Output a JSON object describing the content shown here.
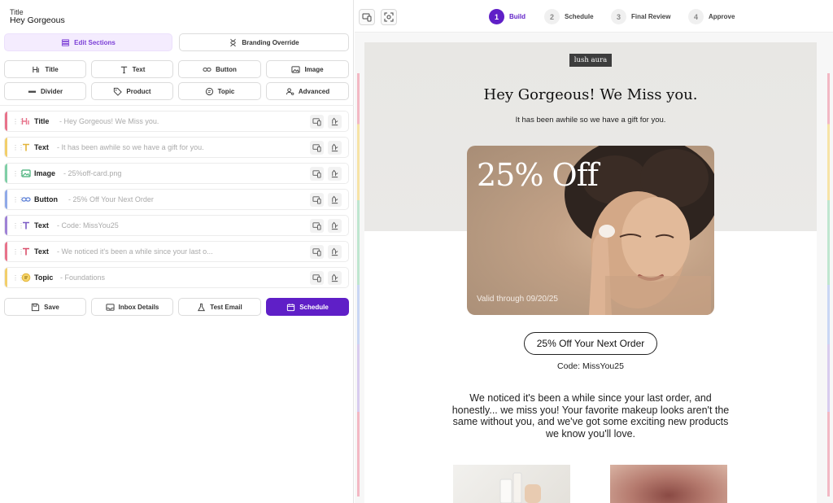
{
  "header": {
    "title_label": "Title",
    "title_value": "Hey Gorgeous"
  },
  "tabs": {
    "edit_sections": "Edit Sections",
    "branding_override": "Branding Override"
  },
  "add_blocks": [
    "Title",
    "Text",
    "Button",
    "Image",
    "Divider",
    "Product",
    "Topic",
    "Advanced"
  ],
  "sections": [
    {
      "kind": "Title",
      "summary": "- Hey Gorgeous! We Miss you.",
      "color": "#e8728a",
      "icon": "title-icon"
    },
    {
      "kind": "Text",
      "summary": "- It has been awhile so we have a gift for you.",
      "color": "#f2cf6b",
      "icon": "text-icon"
    },
    {
      "kind": "Image",
      "summary": "- 25%off-card.png",
      "color": "#7fcfa6",
      "icon": "image-icon"
    },
    {
      "kind": "Button",
      "summary": "- 25% Off Your Next Order",
      "color": "#8fa9e8",
      "icon": "button-link-icon"
    },
    {
      "kind": "Text",
      "summary": "- Code: MissYou25",
      "color": "#9f82d6",
      "icon": "text-icon"
    },
    {
      "kind": "Text",
      "summary": "- We noticed it's been a while since your last o...",
      "color": "#e8728a",
      "icon": "text-icon"
    },
    {
      "kind": "Topic",
      "summary": "- Foundations",
      "color": "#f2cf6b",
      "icon": "topic-icon"
    }
  ],
  "actions": {
    "save": "Save",
    "inbox_details": "Inbox Details",
    "test_email": "Test Email",
    "schedule": "Schedule"
  },
  "steps": [
    {
      "num": "1",
      "label": "Build",
      "active": true
    },
    {
      "num": "2",
      "label": "Schedule",
      "active": false
    },
    {
      "num": "3",
      "label": "Final Review",
      "active": false
    },
    {
      "num": "4",
      "label": "Approve",
      "active": false
    }
  ],
  "email": {
    "brand": "lush aura",
    "title": "Hey Gorgeous! We Miss you.",
    "subtitle": "It has been awhile so we have a gift for you.",
    "promo_heading": "25% Off",
    "promo_valid": "Valid through 09/20/25",
    "cta": "25% Off Your Next Order",
    "code": "Code: MissYou25",
    "paragraph": "We noticed it's been a while since your last order, and honestly... we miss you! Your favorite makeup looks aren't the same without you, and we've got some exciting new products we know you'll love."
  },
  "colors": {
    "accent": "#5f1fc7",
    "accent_light": "#f4ecfe"
  }
}
